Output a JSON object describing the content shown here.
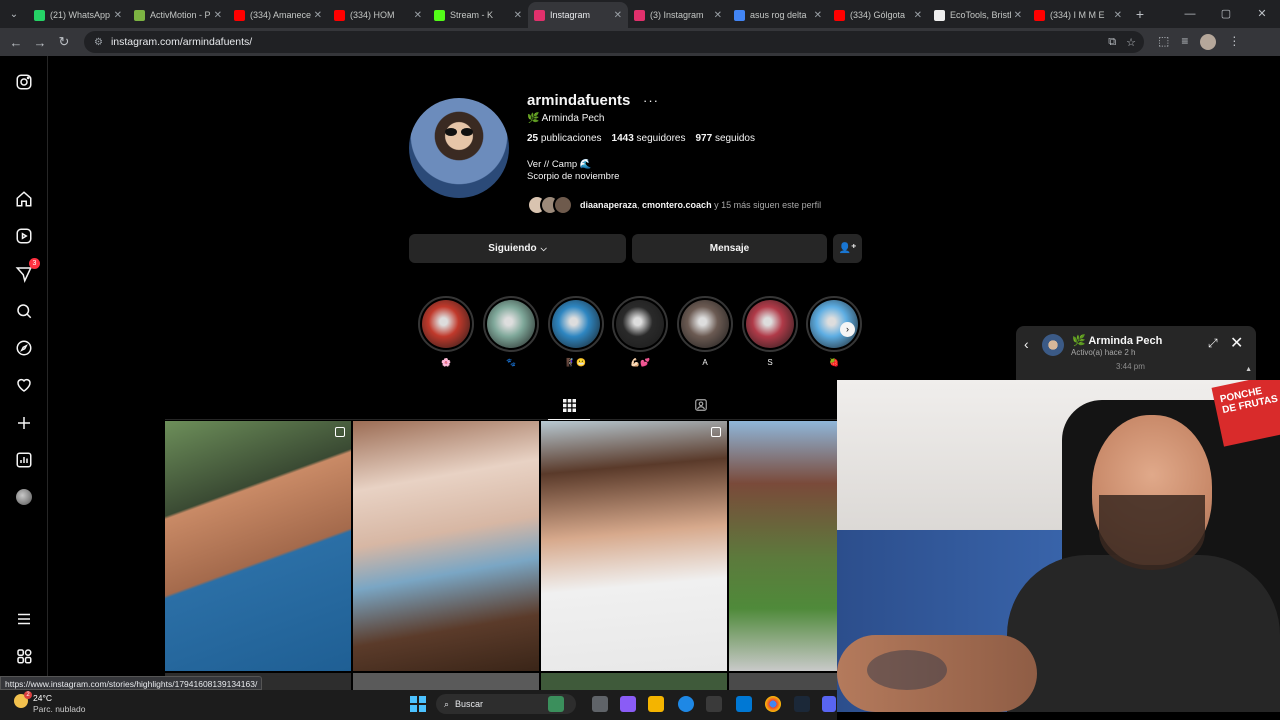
{
  "browser": {
    "tabs": [
      {
        "title": "(21) WhatsApp",
        "color": "#25d366"
      },
      {
        "title": "ActivMotion - P",
        "color": "#7cb342"
      },
      {
        "title": "(334) Amanece",
        "color": "#ff0000"
      },
      {
        "title": "(334) HOM",
        "color": "#ff0000"
      },
      {
        "title": "Stream - K",
        "color": "#53fc18"
      },
      {
        "title": "Instagram",
        "color": "#e1306c",
        "active": true
      },
      {
        "title": "(3) Instagram",
        "color": "#e1306c"
      },
      {
        "title": "asus rog delta",
        "color": "#4285f4"
      },
      {
        "title": "(334) Gólgota",
        "color": "#ff0000"
      },
      {
        "title": "EcoTools, Bristl",
        "color": "#eeeeee"
      },
      {
        "title": "(334) I M M E",
        "color": "#ff0000"
      }
    ],
    "url": "instagram.com/armindafuents/",
    "status_url": "https://www.instagram.com/stories/highlights/17941608139134163/"
  },
  "sidebar": {
    "notifications_badge": "3"
  },
  "profile": {
    "username": "armindafuents",
    "more": "···",
    "full_name": "🌿 Arminda Pech",
    "posts_count": "25",
    "posts_label": "publicaciones",
    "followers_count": "1443",
    "followers_label": "seguidores",
    "following_count": "977",
    "following_label": "seguidos",
    "bio_line1": "Ver // Camp 🌊",
    "bio_line2": "Scorpio de noviembre",
    "followed_by_user1": "diaanaperaza",
    "followed_by_user2": "cmontero.coach",
    "followed_by_rest": "y 15 más siguen este perfil",
    "following_button": "Siguiendo",
    "message_button": "Mensaje"
  },
  "highlights": [
    {
      "label": "🌸",
      "color": "#c0392b"
    },
    {
      "label": "🐾",
      "color": "#7fa89a"
    },
    {
      "label": "🧗🏻‍♀️😬",
      "color": "#2e86c1"
    },
    {
      "label": "💪🏻💕",
      "color": "#2a2a2a"
    },
    {
      "label": "A",
      "color": "#6b5a52"
    },
    {
      "label": "S",
      "color": "#b03a48"
    },
    {
      "label": "🍓",
      "color": "#5dade2"
    }
  ],
  "chat": {
    "name": "🌿 Arminda Pech",
    "status": "Activo(a) hace 2 h",
    "time": "3:44 pm"
  },
  "webcam": {
    "sign_text": "PONCHE DE FRUTAS"
  },
  "taskbar": {
    "temperature": "24°C",
    "condition": "Parc. nublado",
    "search_placeholder": "Buscar",
    "weather_badge": "2"
  }
}
